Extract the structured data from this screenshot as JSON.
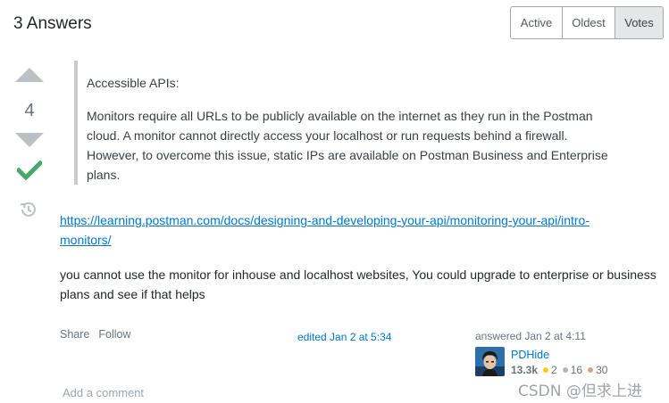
{
  "header": {
    "answers_title": "3 Answers",
    "sort_tabs": [
      {
        "label": "Active"
      },
      {
        "label": "Oldest"
      },
      {
        "label": "Votes",
        "active": true
      }
    ]
  },
  "answer": {
    "vote_count": "4",
    "accepted": true,
    "quote_title": "Accessible APIs:",
    "quote_body": "Monitors require all URLs to be publicly available on the internet as they run in the Postman cloud. A monitor cannot directly access your localhost or run requests behind a firewall. However, to overcome this issue, static IPs are available on Postman Business and Enterprise plans.",
    "link_text": "https://learning.postman.com/docs/designing-and-developing-your-api/monitoring-your-api/intro-monitors/",
    "paragraph": "you cannot use the monitor for inhouse and localhost websites, You could upgrade to enterprise or business plans and see if that helps",
    "menu": {
      "share": "Share",
      "follow": "Follow"
    },
    "edited": "edited Jan 2 at 5:34",
    "user": {
      "answered": "answered Jan 2 at 4:11",
      "name": "PDHide",
      "reputation": "13.3k",
      "gold": "2",
      "silver": "16",
      "bronze": "30"
    },
    "add_comment": "Add a comment"
  },
  "watermark": "CSDN @但求上进",
  "colors": {
    "accept_green": "#48a868",
    "link_blue": "#0077cc",
    "gold": "#ffcc01",
    "silver": "#b4b8bc",
    "bronze": "#d1a684"
  }
}
